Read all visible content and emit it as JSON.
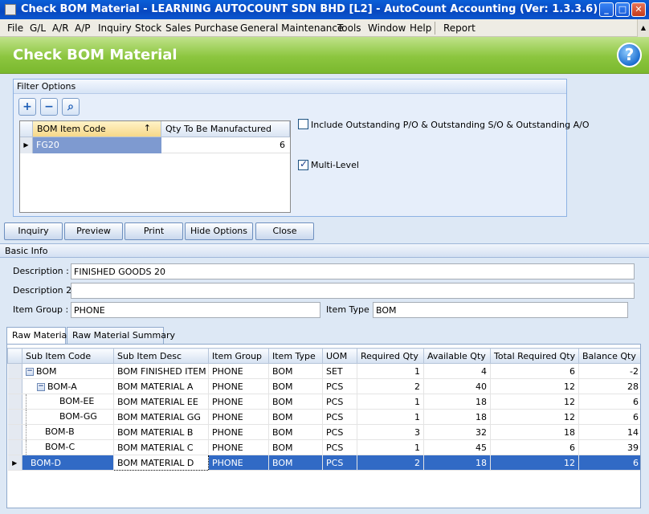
{
  "window": {
    "title": "Check BOM Material - LEARNING AUTOCOUNT SDN BHD [L2] - AutoCount Accounting (Ver: 1.3.3.6)"
  },
  "menu": [
    "File",
    "G/L",
    "A/R",
    "A/P",
    "Inquiry",
    "Stock",
    "Sales",
    "Purchase",
    "General Maintenance",
    "Tools",
    "Window",
    "Help",
    "Report"
  ],
  "header": {
    "title": "Check BOM Material",
    "help_label": "?"
  },
  "filter": {
    "group_label": "Filter Options",
    "columns": [
      "BOM Item Code",
      "Qty To Be Manufactured"
    ],
    "rows": [
      {
        "code": "FG20",
        "qty": "6"
      }
    ],
    "include_outstanding": {
      "label": "Include Outstanding P/O & Outstanding S/O & Outstanding A/O",
      "checked": false
    },
    "multi_level": {
      "label": "Multi-Level",
      "checked": true
    }
  },
  "buttons": {
    "inquiry": "Inquiry",
    "preview": "Preview",
    "print": "Print",
    "hide_options": "Hide Options",
    "close": "Close"
  },
  "basic_info": {
    "section_label": "Basic Info",
    "description_label": "Description :",
    "description": "FINISHED GOODS 20",
    "description2_label": "Description 2",
    "description2": "",
    "item_group_label": "Item Group :",
    "item_group": "PHONE",
    "item_type_label": "Item Type :",
    "item_type": "BOM"
  },
  "tabs": [
    "Raw Material",
    "Raw Material Summary"
  ],
  "grid": {
    "columns": [
      "Sub Item Code",
      "Sub Item Desc",
      "Item Group",
      "Item Type",
      "UOM",
      "Required Qty",
      "Available Qty",
      "Total Required Qty",
      "Balance Qty"
    ],
    "rows": [
      {
        "code": "BOM",
        "desc": "BOM FINISHED ITEM",
        "group": "PHONE",
        "type": "BOM",
        "uom": "SET",
        "req": "1",
        "avail": "4",
        "total": "6",
        "bal": "-2"
      },
      {
        "code": "BOM-A",
        "desc": "BOM MATERIAL A",
        "group": "PHONE",
        "type": "BOM",
        "uom": "PCS",
        "req": "2",
        "avail": "40",
        "total": "12",
        "bal": "28"
      },
      {
        "code": "BOM-EE",
        "desc": "BOM MATERIAL EE",
        "group": "PHONE",
        "type": "BOM",
        "uom": "PCS",
        "req": "1",
        "avail": "18",
        "total": "12",
        "bal": "6"
      },
      {
        "code": "BOM-GG",
        "desc": "BOM MATERIAL GG",
        "group": "PHONE",
        "type": "BOM",
        "uom": "PCS",
        "req": "1",
        "avail": "18",
        "total": "12",
        "bal": "6"
      },
      {
        "code": "BOM-B",
        "desc": "BOM MATERIAL B",
        "group": "PHONE",
        "type": "BOM",
        "uom": "PCS",
        "req": "3",
        "avail": "32",
        "total": "18",
        "bal": "14"
      },
      {
        "code": "BOM-C",
        "desc": "BOM MATERIAL C",
        "group": "PHONE",
        "type": "BOM",
        "uom": "PCS",
        "req": "1",
        "avail": "45",
        "total": "6",
        "bal": "39"
      },
      {
        "code": "BOM-D",
        "desc": "BOM MATERIAL D",
        "group": "PHONE",
        "type": "BOM",
        "uom": "PCS",
        "req": "2",
        "avail": "18",
        "total": "12",
        "bal": "6"
      }
    ]
  }
}
